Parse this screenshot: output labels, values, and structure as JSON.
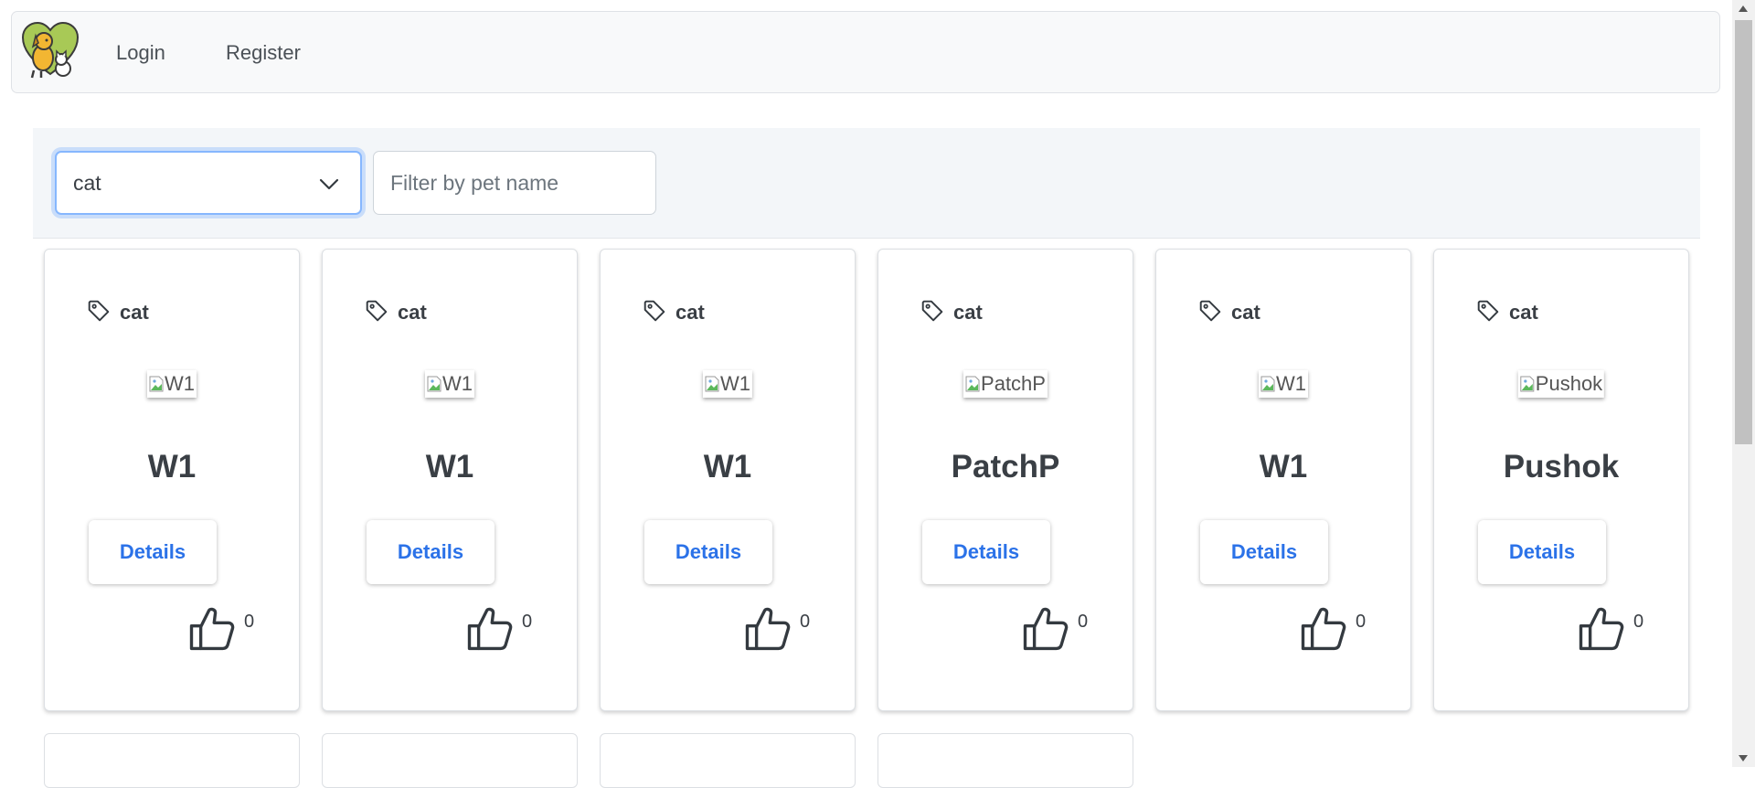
{
  "navbar": {
    "logo_icon": "dog-cat-heart-logo",
    "links": {
      "login": "Login",
      "register": "Register"
    }
  },
  "filters": {
    "pet_type_selected": "cat",
    "name_placeholder": "Filter by pet name",
    "name_value": ""
  },
  "cards": [
    {
      "type": "cat",
      "image_alt": "W1",
      "name": "W1",
      "details_label": "Details",
      "likes": "0"
    },
    {
      "type": "cat",
      "image_alt": "W1",
      "name": "W1",
      "details_label": "Details",
      "likes": "0"
    },
    {
      "type": "cat",
      "image_alt": "W1",
      "name": "W1",
      "details_label": "Details",
      "likes": "0"
    },
    {
      "type": "cat",
      "image_alt": "PatchP",
      "name": "PatchP",
      "details_label": "Details",
      "likes": "0"
    },
    {
      "type": "cat",
      "image_alt": "W1",
      "name": "W1",
      "details_label": "Details",
      "likes": "0"
    },
    {
      "type": "cat",
      "image_alt": "Pushok",
      "name": "Pushok",
      "details_label": "Details",
      "likes": "0"
    }
  ],
  "icons": {
    "tag": "tag-icon",
    "like": "thumbs-up-icon",
    "broken_image": "broken-image-icon",
    "select_chevron": "chevron-down-icon"
  },
  "colors": {
    "accent_link": "#2b72e8",
    "focus_ring": "#86b7fe",
    "navbar_bg": "#f8f9fa",
    "filter_bg": "#f3f6f9"
  }
}
